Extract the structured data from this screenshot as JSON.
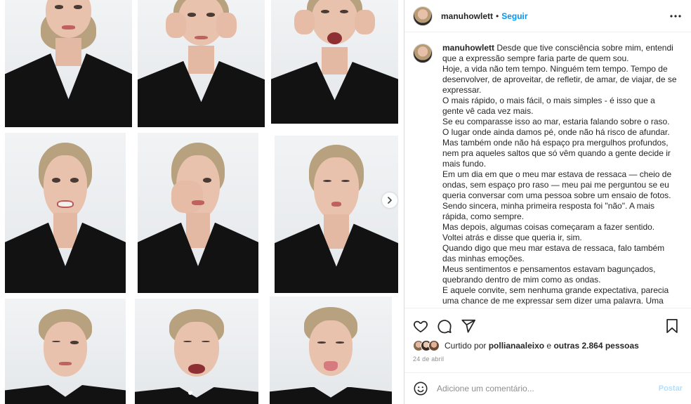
{
  "header": {
    "username": "manuhowlett",
    "separator": "•",
    "follow_label": "Seguir"
  },
  "caption": {
    "username": "manuhowlett",
    "paragraphs": [
      "Desde que tive consciência sobre mim, entendi que a expressão sempre faria parte de quem sou.",
      "Hoje, a vida não tem tempo. Ninguém tem tempo. Tempo de desenvolver, de aproveitar, de refletir, de amar, de viajar, de se expressar.",
      "O mais rápido, o mais fácil, o mais simples - é isso que a gente vê cada vez mais.",
      "Se eu comparasse isso ao mar, estaria falando sobre o raso.",
      "O lugar onde ainda damos pé, onde não há risco de afundar.",
      "Mas também onde não há espaço pra mergulhos profundos, nem pra aqueles saltos que só vêm quando a gente decide ir mais fundo.",
      "Em um dia em que o meu mar estava de ressaca — cheio de ondas, sem espaço pro raso — meu pai me perguntou se eu queria conversar com uma pessoa sobre um ensaio de fotos.",
      "Sendo sincera, minha primeira resposta foi \"não\". A mais rápida, como sempre.",
      "Mas depois, algumas coisas começaram a fazer sentido. Voltei atrás e disse que queria ir, sim.",
      "Quando digo que meu mar estava de ressaca, falo também das minhas emoções.",
      "Meus sentimentos e pensamentos estavam bagunçados, quebrando dentro de mim como as ondas.",
      "E aquele convite, sem nenhuma grande expectativa, parecia uma chance de me expressar sem dizer uma palavra. Uma chance de"
    ]
  },
  "likes": {
    "prefix": "Curtido por",
    "user": "pollianaaleixo",
    "connector": "e",
    "others": "outras 2.864 pessoas"
  },
  "date": "24 de abril",
  "comment": {
    "placeholder": "Adicione um comentário...",
    "post_label": "Postar"
  },
  "icons": {
    "more": "more-horizontal-icon",
    "like": "heart-icon",
    "comment": "comment-bubble-icon",
    "share": "paper-plane-icon",
    "save": "bookmark-icon",
    "emoji": "smiley-icon",
    "next": "chevron-right-icon"
  },
  "colors": {
    "accent": "#0095f6",
    "post_disabled": "#b2dffc",
    "muted": "#8e8e8e",
    "text": "#262626"
  }
}
